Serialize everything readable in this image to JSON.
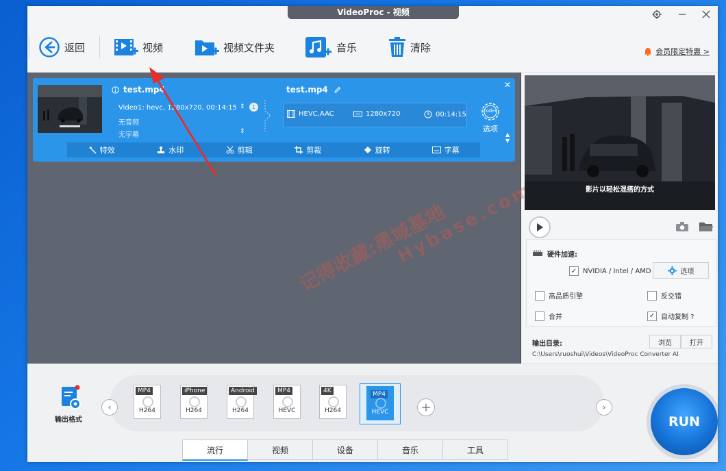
{
  "window": {
    "title": "VideoProc - 视频"
  },
  "toolbar": {
    "back": "返回",
    "video": "视频",
    "video_folder": "视频文件夹",
    "music": "音乐",
    "clear": "清除",
    "promo": "会员限定特惠 >"
  },
  "file": {
    "source_name": "test.mp4",
    "video_track": "Video1: hevc, 1280x720, 00:14:15",
    "track_count": "1",
    "audio": "无音频",
    "subtitle": "无字幕",
    "output_name": "test.mp4",
    "codec": "HEVC,AAC",
    "resolution": "1280x720",
    "duration": "00:14:15",
    "options_label": "选项",
    "codec_badge": "codec"
  },
  "edit_tools": [
    {
      "label": "特效"
    },
    {
      "label": "水印"
    },
    {
      "label": "剪辑"
    },
    {
      "label": "剪裁"
    },
    {
      "label": "旋转"
    },
    {
      "label": "字幕"
    }
  ],
  "preview": {
    "subtitle_text": "影片以轻松混搭的方式"
  },
  "settings": {
    "hw_accel_label": "硬件加速:",
    "gpu_label": "NVIDIA / Intel / AMD",
    "gpu_checked": true,
    "options_button": "选项",
    "high_quality": "高品质引擎",
    "deinterlace": "反交错",
    "merge": "合并",
    "auto_copy": "自动复制 ?",
    "auto_copy_checked": true
  },
  "output": {
    "label": "输出目录:",
    "browse": "浏览",
    "open": "打开",
    "path": "C:\\Users\\ruoshui\\Videos\\VideoProc Converter AI"
  },
  "formats": {
    "output_format_label": "输出格式",
    "items": [
      {
        "tag": "MP4",
        "codec": "H264"
      },
      {
        "tag": "iPhone",
        "codec": "H264"
      },
      {
        "tag": "Android",
        "codec": "H264"
      },
      {
        "tag": "MP4",
        "codec": "HEVC"
      },
      {
        "tag": "4K",
        "codec": "H264"
      },
      {
        "tag": "MP4",
        "codec": "HEVC"
      }
    ],
    "selected_index": 5
  },
  "tabs": [
    {
      "label": "流行"
    },
    {
      "label": "视频"
    },
    {
      "label": "设备"
    },
    {
      "label": "音乐"
    },
    {
      "label": "工具"
    }
  ],
  "run_label": "RUN",
  "watermark": {
    "cn": "记得收藏:黑域基地",
    "en": "Hybase.com"
  },
  "colors": {
    "accent": "#2b95ea",
    "promo_bell": "#ff6a1a"
  }
}
